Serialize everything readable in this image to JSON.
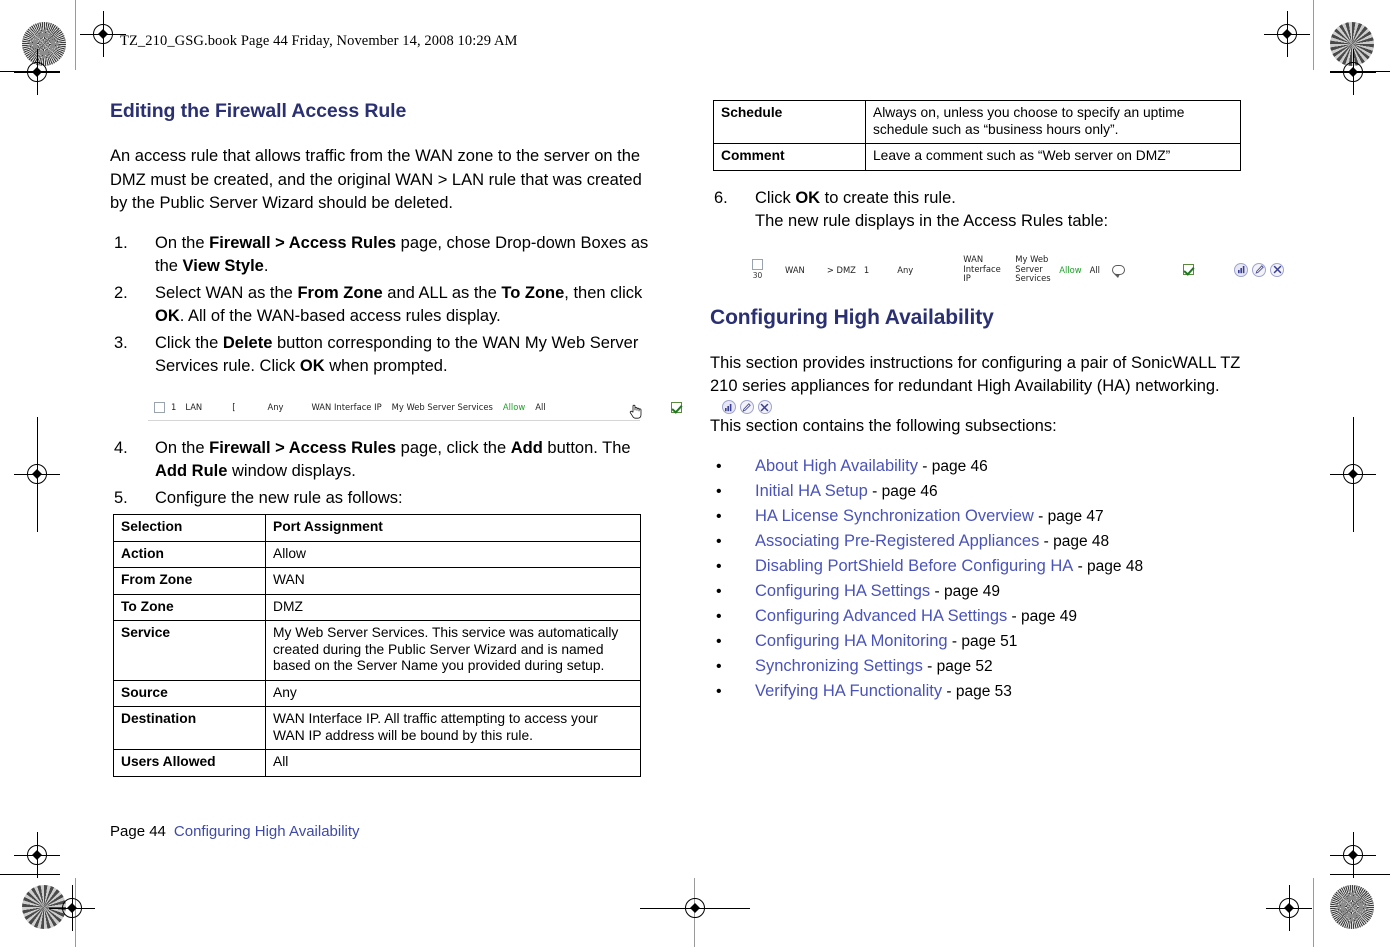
{
  "book_header": "TZ_210_GSG.book  Page 44  Friday, November 14, 2008  10:29 AM",
  "colors": {
    "heading": "#2a3071",
    "link": "#4a53b8",
    "allow_green": "#1f9d2a",
    "rule_line": "#d6d6d6"
  },
  "left_column": {
    "heading": "Editing the Firewall Access Rule",
    "intro": "An access rule that allows traffic from the WAN zone to the server on the DMZ must be created, and the original WAN > LAN rule that was created by the Public Server Wizard should be deleted.",
    "steps": [
      {
        "num": "1.",
        "parts": [
          {
            "t": "On the ",
            "b": false
          },
          {
            "t": "Firewall > Access Rules",
            "b": true
          },
          {
            "t": " page, chose Drop-down Boxes as the ",
            "b": false
          },
          {
            "t": "View Style",
            "b": true
          },
          {
            "t": ".",
            "b": false
          }
        ]
      },
      {
        "num": "2.",
        "parts": [
          {
            "t": "Select WAN as the ",
            "b": false
          },
          {
            "t": "From Zone",
            "b": true
          },
          {
            "t": " and ALL as the ",
            "b": false
          },
          {
            "t": "To Zone",
            "b": true
          },
          {
            "t": ", then click ",
            "b": false
          },
          {
            "t": "OK",
            "b": true
          },
          {
            "t": ". All of the WAN-based access rules display.",
            "b": false
          }
        ]
      },
      {
        "num": "3.",
        "parts": [
          {
            "t": "Click the ",
            "b": false
          },
          {
            "t": "Delete",
            "b": true
          },
          {
            "t": " button corresponding to the WAN My Web Server Services rule. Click ",
            "b": false
          },
          {
            "t": "OK",
            "b": true
          },
          {
            "t": " when prompted.",
            "b": false
          }
        ]
      }
    ],
    "steps_after": [
      {
        "num": "4.",
        "parts": [
          {
            "t": "On the ",
            "b": false
          },
          {
            "t": "Firewall > Access Rules",
            "b": true
          },
          {
            "t": " page, click the ",
            "b": false
          },
          {
            "t": "Add",
            "b": true
          },
          {
            "t": " button. The ",
            "b": false
          },
          {
            "t": "Add Rule",
            "b": true
          },
          {
            "t": " window displays.",
            "b": false
          }
        ]
      },
      {
        "num": "5.",
        "parts": [
          {
            "t": "Configure the new rule as follows:",
            "b": false
          }
        ]
      }
    ],
    "rule_screenshot": {
      "checkbox_checked": false,
      "index": "1",
      "zone_from": "LAN",
      "arrow": "[",
      "source": "Any",
      "destination": "WAN Interface IP",
      "service": "My Web Server Services",
      "action": "Allow",
      "users": "All",
      "enable_checked": true,
      "icons": [
        "stats-icon",
        "edit-icon",
        "delete-icon"
      ],
      "cursor": "hand-cursor"
    },
    "table": {
      "headers": [
        "Selection",
        "Port Assignment"
      ],
      "rows": [
        [
          "Action",
          "Allow"
        ],
        [
          "From Zone",
          "WAN"
        ],
        [
          "To Zone",
          "DMZ"
        ],
        [
          "Service",
          "My Web Server Services. This service was automatically created during the Public Server Wizard and is named based on the Server Name you provided during setup."
        ],
        [
          "Source",
          "Any"
        ],
        [
          "Destination",
          "WAN Interface IP. All traffic attempting to access your WAN IP address will be bound by this rule."
        ],
        [
          "Users Allowed",
          "All"
        ]
      ]
    }
  },
  "right_column": {
    "table_cont": {
      "rows": [
        [
          "Schedule",
          "Always on, unless you choose to specify an uptime schedule such as “business hours only”."
        ],
        [
          "Comment",
          "Leave a comment such as “Web server on DMZ”"
        ]
      ]
    },
    "step6": {
      "num": "6.",
      "parts": [
        {
          "t": "Click ",
          "b": false
        },
        {
          "t": "OK",
          "b": true
        },
        {
          "t": " to create this rule.",
          "b": false
        }
      ],
      "line2": "The new rule displays in the Access Rules table:"
    },
    "rule_screenshot": {
      "checkbox_checked": false,
      "checkbox_sub": "30",
      "zone_from": "WAN",
      "arrow": "> DMZ",
      "index": "1",
      "source": "Any",
      "destination": "WAN Interface IP",
      "service": "My Web Server Services",
      "action": "Allow",
      "users": "All",
      "comment_icon": "comment-bubble-icon",
      "enable_checked": true,
      "icons": [
        "stats-icon",
        "edit-icon",
        "delete-icon"
      ]
    },
    "heading": "Configuring High Availability",
    "para1": "This section provides instructions for configuring a pair of SonicWALL TZ 210 series appliances for redundant High Availability (HA) networking.",
    "para2": "This section contains the following subsections:",
    "links": [
      {
        "label": "About High Availability",
        "page": "- page 46"
      },
      {
        "label": "Initial HA Setup",
        "page": "- page 46"
      },
      {
        "label": "HA License Synchronization Overview",
        "page": "- page 47"
      },
      {
        "label": "Associating Pre-Registered Appliances",
        "page": "- page 48"
      },
      {
        "label": "Disabling PortShield Before Configuring HA",
        "page": "- page 48"
      },
      {
        "label": "Configuring HA Settings",
        "page": "- page 49"
      },
      {
        "label": "Configuring Advanced HA Settings",
        "page": "- page 49"
      },
      {
        "label": "Configuring HA Monitoring",
        "page": "- page 51"
      },
      {
        "label": "Synchronizing Settings",
        "page": "- page 52"
      },
      {
        "label": "Verifying HA Functionality",
        "page": "- page 53"
      }
    ]
  },
  "footer": {
    "page": "Page 44",
    "title": "Configuring High Availability"
  }
}
